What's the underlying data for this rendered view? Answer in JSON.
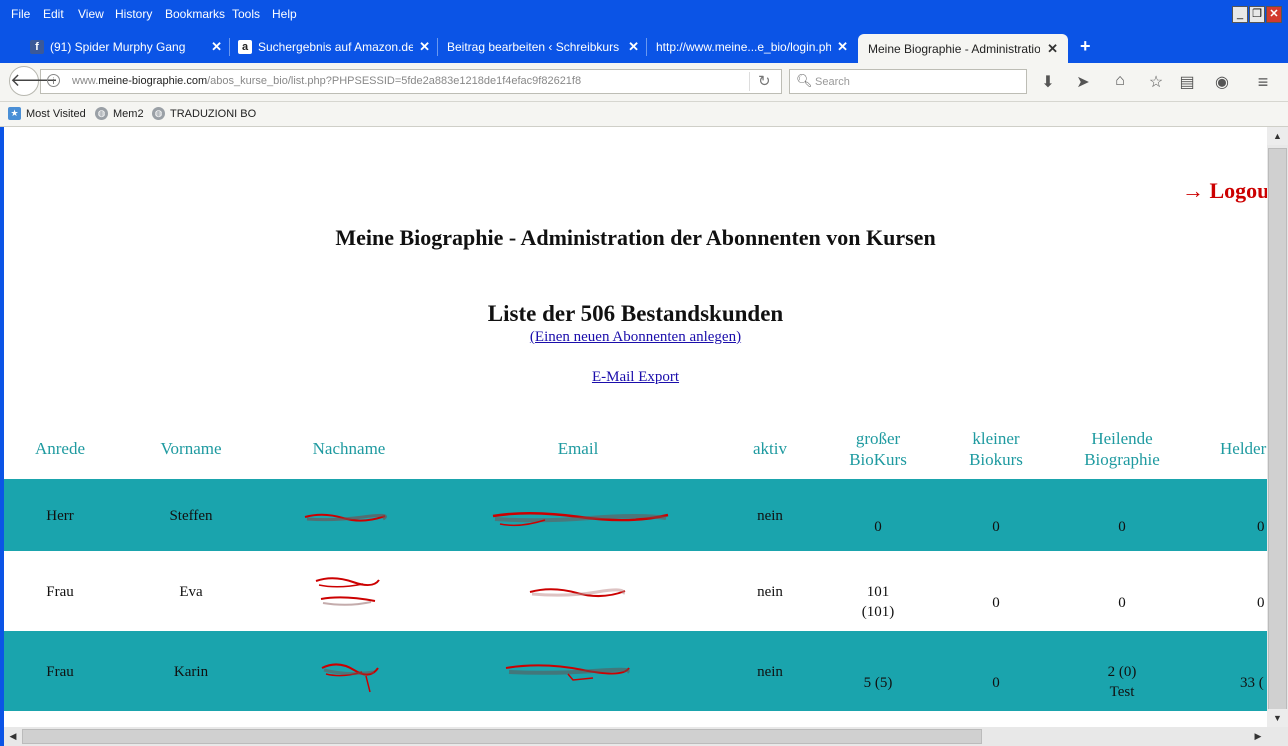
{
  "menu": [
    "File",
    "Edit",
    "View",
    "History",
    "Bookmarks",
    "Tools",
    "Help"
  ],
  "window_controls": [
    "_",
    "❐",
    "✕"
  ],
  "tabs": [
    {
      "title": "(91) Spider Murphy Gang",
      "favicon": "f",
      "favicon_color": "#3b5998"
    },
    {
      "title": "Suchergebnis auf Amazon.de ...",
      "favicon": "a",
      "favicon_color": "#222222"
    },
    {
      "title": "Beitrag bearbeiten ‹ Schreibkurse ...",
      "favicon": "",
      "favicon_color": ""
    },
    {
      "title": "http://www.meine...e_bio/login.php",
      "favicon": "",
      "favicon_color": ""
    },
    {
      "title": "Meine Biographie - Administration ...",
      "favicon": "",
      "favicon_color": ""
    }
  ],
  "new_tab_label": "+",
  "url": {
    "prefix": "www.",
    "domain": "meine-biographie.com",
    "path": "/abos_kurse_bio/list.php?PHPSESSID=5fde2a883e1218de1f4efac9f82621f8"
  },
  "search_placeholder": "Search",
  "bookmarks": [
    "Most Visited",
    "Mem2",
    "TRADUZIONI BO"
  ],
  "page": {
    "logout": "→ Logout",
    "title": "Meine Biographie - Administration der Abonnenten von Kursen",
    "list_title": "Liste der 506 Bestandskunden",
    "new_subscriber_link": "(Einen neuen Abonnenten anlegen)",
    "export_link": "E-Mail Export"
  },
  "table": {
    "headers": [
      {
        "l1": "Anrede",
        "l2": ""
      },
      {
        "l1": "Vorname",
        "l2": ""
      },
      {
        "l1": "Nachname",
        "l2": ""
      },
      {
        "l1": "Email",
        "l2": ""
      },
      {
        "l1": "aktiv",
        "l2": ""
      },
      {
        "l1": "großer",
        "l2": "BioKurs"
      },
      {
        "l1": "kleiner",
        "l2": "Biokurs"
      },
      {
        "l1": "Heilende",
        "l2": "Biographie"
      },
      {
        "l1": "Helder",
        "l2": ""
      }
    ],
    "rows": [
      {
        "anrede": "Herr",
        "vorname": "Steffen",
        "aktiv": "nein",
        "gross_l1": "0",
        "gross_l2": "",
        "klein": "0",
        "heil_l1": "0",
        "heil_l2": "",
        "held": "0",
        "style": "teal"
      },
      {
        "anrede": "Frau",
        "vorname": "Eva",
        "aktiv": "nein",
        "gross_l1": "101",
        "gross_l2": "(101)",
        "klein": "0",
        "heil_l1": "0",
        "heil_l2": "",
        "held": "0",
        "style": "white"
      },
      {
        "anrede": "Frau",
        "vorname": "Karin",
        "aktiv": "nein",
        "gross_l1": "5 (5)",
        "gross_l2": "",
        "klein": "0",
        "heil_l1": "2 (0)",
        "heil_l2": "Test",
        "held": "33 (",
        "style": "teal"
      }
    ]
  },
  "colors": {
    "browser_blue": "#0b54e6",
    "teal_row": "#1aa4ad",
    "header_text": "#1e9aa0",
    "logout_red": "#cc0000",
    "link": "#1a0dab"
  }
}
